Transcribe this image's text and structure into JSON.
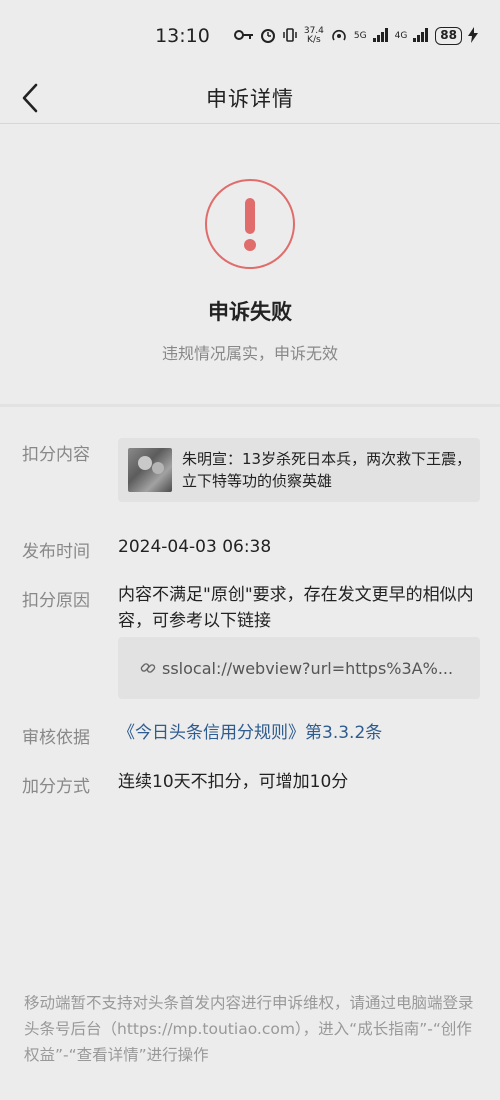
{
  "status_bar": {
    "time": "13:10",
    "net_speed_value": "37.4",
    "net_speed_unit": "K/s",
    "signal_1": "5G",
    "signal_2": "4G",
    "battery": "88",
    "icons": [
      "key-icon",
      "alarm-icon",
      "vibrate-icon",
      "hotspot-icon",
      "signal-icon",
      "charging-icon"
    ]
  },
  "header": {
    "title": "申诉详情"
  },
  "result": {
    "title": "申诉失败",
    "subtitle": "违规情况属实，申诉无效",
    "accent_color": "#e06c6c"
  },
  "details": {
    "deduction_content": {
      "label": "扣分内容",
      "article_title": "朱明宣：13岁杀死日本兵，两次救下王震，立下特等功的侦察英雄"
    },
    "publish_time": {
      "label": "发布时间",
      "value": "2024-04-03 06:38"
    },
    "deduction_reason": {
      "label": "扣分原因",
      "value": "内容不满足\"原创\"要求，存在发文更早的相似内容，可参考以下链接",
      "link": "sslocal://webview?url=https%3A%..."
    },
    "review_basis": {
      "label": "审核依据",
      "value": "《今日头条信用分规则》第3.3.2条"
    },
    "add_points": {
      "label": "加分方式",
      "value": "连续10天不扣分，可增加10分"
    }
  },
  "footer": {
    "text": "移动端暂不支持对头条首发内容进行申诉维权，请通过电脑端登录头条号后台（https://mp.toutiao.com），进入“成长指南”-“创作权益”-“查看详情”进行操作"
  }
}
